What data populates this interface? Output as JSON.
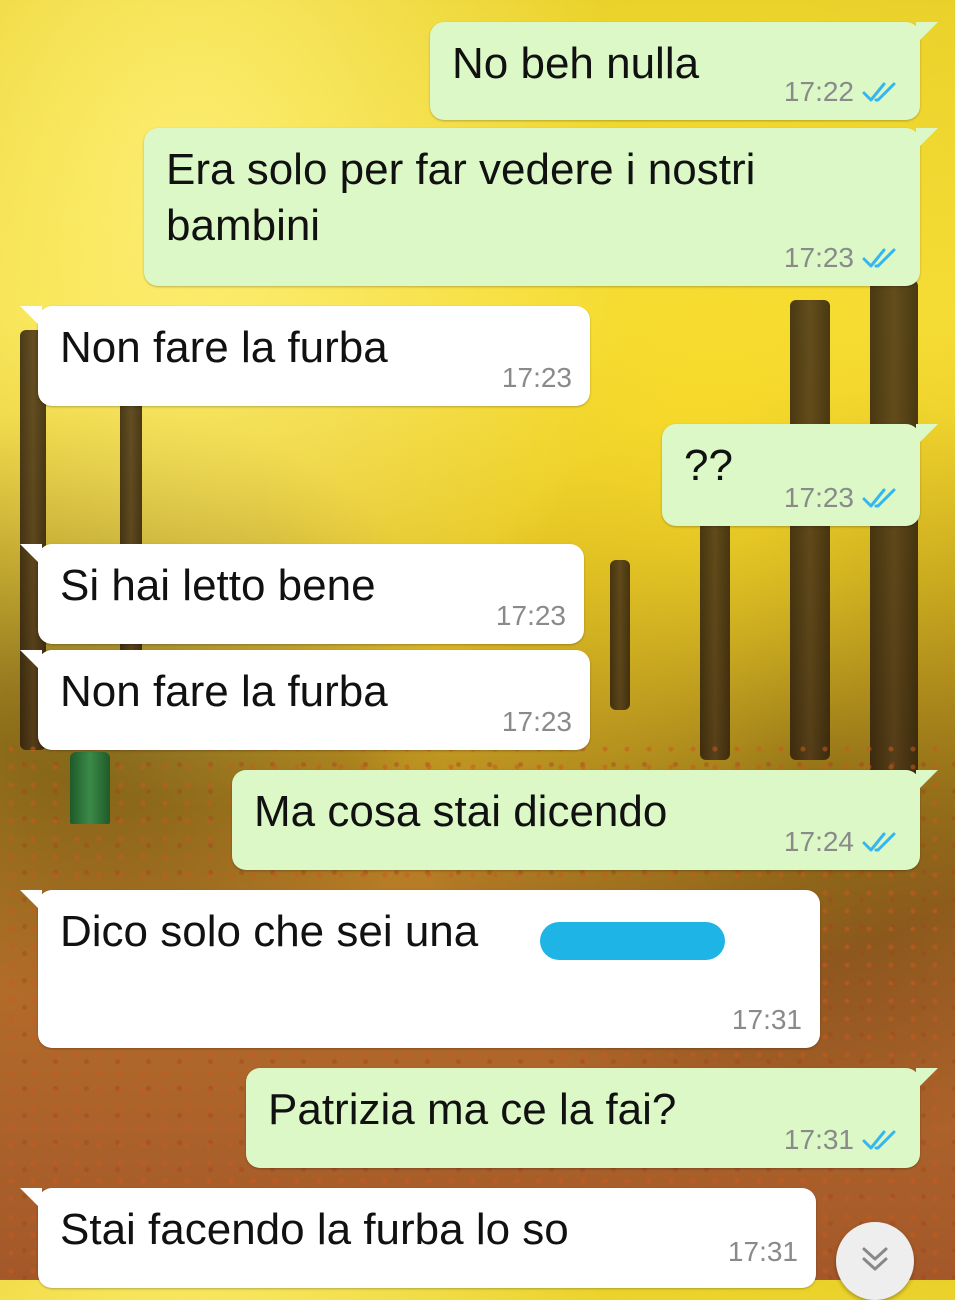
{
  "messages": [
    {
      "direction": "out",
      "text": "No beh nulla",
      "time": "17:22",
      "status": "read"
    },
    {
      "direction": "out",
      "text": "Era solo per far vedere i nostri\nbambini",
      "time": "17:23",
      "status": "read"
    },
    {
      "direction": "in",
      "text": "Non fare la furba",
      "time": "17:23"
    },
    {
      "direction": "out",
      "text": "??",
      "time": "17:23",
      "status": "read"
    },
    {
      "direction": "in",
      "text": "Si hai letto bene",
      "time": "17:23"
    },
    {
      "direction": "in",
      "text": "Non fare la furba",
      "time": "17:23"
    },
    {
      "direction": "out",
      "text": "Ma cosa stai dicendo",
      "time": "17:24",
      "status": "read"
    },
    {
      "direction": "in",
      "text": "Dico solo che sei una",
      "time": "17:31",
      "redacted": true
    },
    {
      "direction": "out",
      "text": "Patrizia ma ce la fai?",
      "time": "17:31",
      "status": "read"
    },
    {
      "direction": "in",
      "text": "Stai facendo la furba lo so",
      "time": "17:31"
    }
  ],
  "colors": {
    "outgoing_bubble": "#dcf8c6",
    "incoming_bubble": "#ffffff",
    "read_ticks": "#34b7f1",
    "redaction": "#1fb4e6"
  },
  "icons": {
    "read_receipt": "double-check-icon",
    "scroll_down": "double-chevron-down-icon"
  }
}
